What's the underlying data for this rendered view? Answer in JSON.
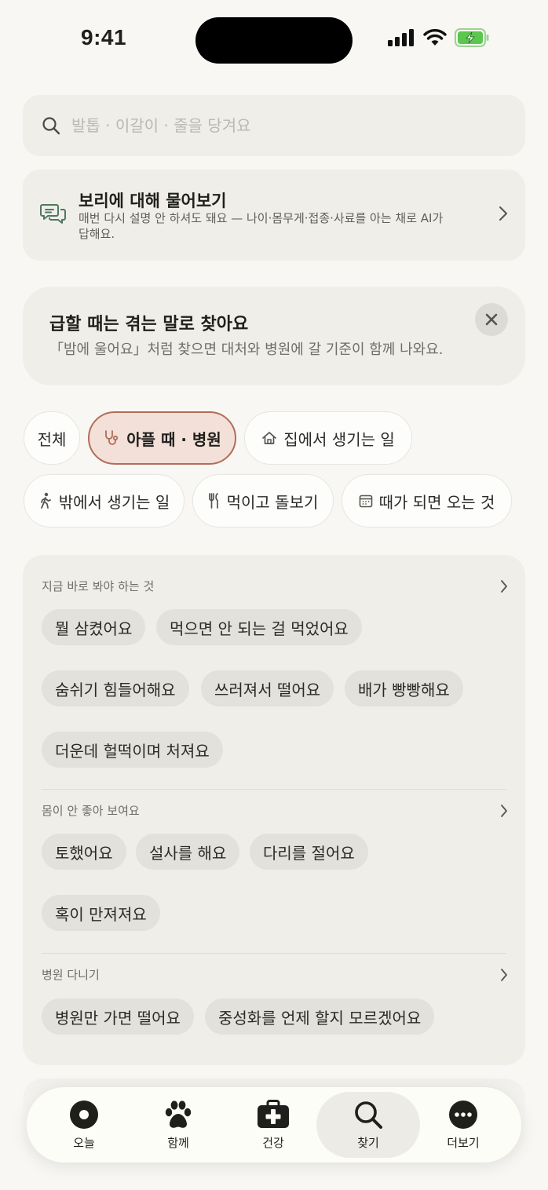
{
  "status_bar": {
    "time": "9:41"
  },
  "search": {
    "placeholder": "발톱 · 이갈이 · 줄을 당겨요"
  },
  "ask_card": {
    "title": "보리에 대해 물어보기",
    "description": "매번 다시 설명 안 하셔도 돼요 — 나이·몸무게·접종·사료를 아는 채로 AI가 답해요."
  },
  "tip_card": {
    "title": "급할 때는 겪는 말로 찾아요",
    "description": "「밤에 울어요」처럼 찾으면 대처와 병원에 갈 기준이 함께 나와요."
  },
  "filters": [
    {
      "label": "전체",
      "icon": "none"
    },
    {
      "label": "아플 때 · 병원",
      "icon": "stethoscope-icon",
      "active": true
    },
    {
      "label": "집에서 생기는 일",
      "icon": "home-icon"
    },
    {
      "label": "밖에서 생기는 일",
      "icon": "walking-icon"
    },
    {
      "label": "먹이고 돌보기",
      "icon": "fork-knife-icon"
    },
    {
      "label": "때가 되면 오는 것",
      "icon": "calendar-icon"
    }
  ],
  "sections": [
    {
      "title": "지금 바로 봐야 하는 것",
      "tags": [
        "뭘 삼켰어요",
        "먹으면 안 되는 걸 먹었어요",
        "숨쉬기 힘들어해요",
        "쓰러져서 떨어요",
        "배가 빵빵해요",
        "더운데 헐떡이며 처져요"
      ]
    },
    {
      "title": "몸이 안 좋아 보여요",
      "tags": [
        "토했어요",
        "설사를 해요",
        "다리를 절어요",
        "혹이 만져져요"
      ]
    },
    {
      "title": "병원 다니기",
      "tags": [
        "병원만 가면 떨어요",
        "중성화를 언제 할지 모르겠어요"
      ]
    }
  ],
  "nav": [
    {
      "label": "오늘",
      "icon": "today-icon"
    },
    {
      "label": "함께",
      "icon": "paw-icon"
    },
    {
      "label": "건강",
      "icon": "medkit-icon"
    },
    {
      "label": "찾기",
      "icon": "search-icon",
      "active": true
    },
    {
      "label": "더보기",
      "icon": "more-icon"
    }
  ],
  "colors": {
    "background": "#f8f7f4",
    "card": "#efeee9",
    "accent": "#b26d58",
    "accent_bg": "#f3e0d9",
    "ask_icon": "#4e7a5e",
    "battery": "#5ac84f"
  }
}
